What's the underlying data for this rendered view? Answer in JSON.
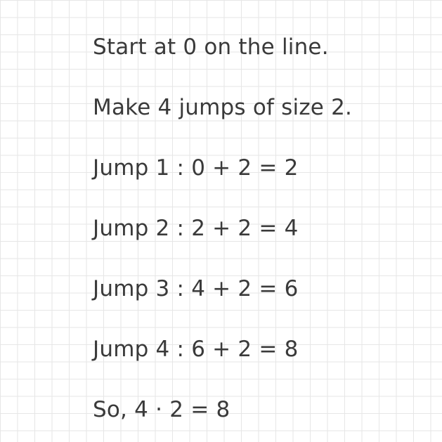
{
  "worksheet": {
    "lines": [
      "Start at 0 on the line.",
      "Make 4 jumps of size 2.",
      "Jump 1 : 0 + 2 = 2",
      "Jump 2 : 2 + 2 = 4",
      "Jump 3 : 4 + 2 = 6",
      "Jump 4 : 6 + 2 = 8",
      "So, 4 · 2 = 8"
    ]
  }
}
